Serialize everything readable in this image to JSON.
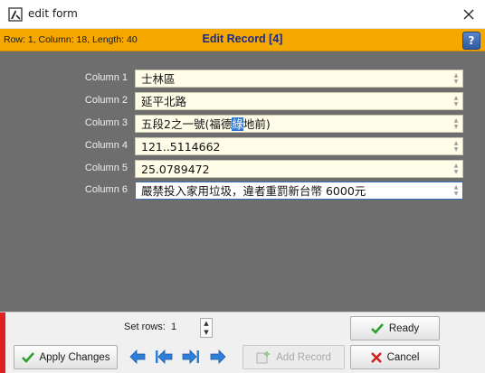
{
  "window": {
    "title": "edit form"
  },
  "status": {
    "position_text": "Row: 1, Column: 18, Length: 40",
    "record_title": "Edit Record [4]",
    "help_label": "?"
  },
  "fields": [
    {
      "label": "Column 1",
      "value": "士林區"
    },
    {
      "label": "Column 2",
      "value": "延平北路"
    },
    {
      "label": "Column 3",
      "value_before": "五段2之一號(福德",
      "value_selected": "綠",
      "value_after": "地前)"
    },
    {
      "label": "Column 4",
      "value": "121..5114662"
    },
    {
      "label": "Column 5",
      "value": "25.0789472"
    },
    {
      "label": "Column 6",
      "value": "嚴禁投入家用垃圾，違者重罰新台幣 6000元"
    }
  ],
  "bottom": {
    "set_rows_label": "Set rows:",
    "set_rows_value": "1",
    "apply_label": "Apply Changes",
    "add_record_label": "Add Record",
    "ready_label": "Ready",
    "cancel_label": "Cancel"
  },
  "colors": {
    "status_bar": "#f5a800",
    "record_title": "#1a2a8a",
    "field_bg": "#fffde8",
    "main_bg": "#6e6e6e",
    "nav_arrow": "#2f7fd8",
    "ready_check": "#2ca02c",
    "cancel_x": "#d02020"
  }
}
